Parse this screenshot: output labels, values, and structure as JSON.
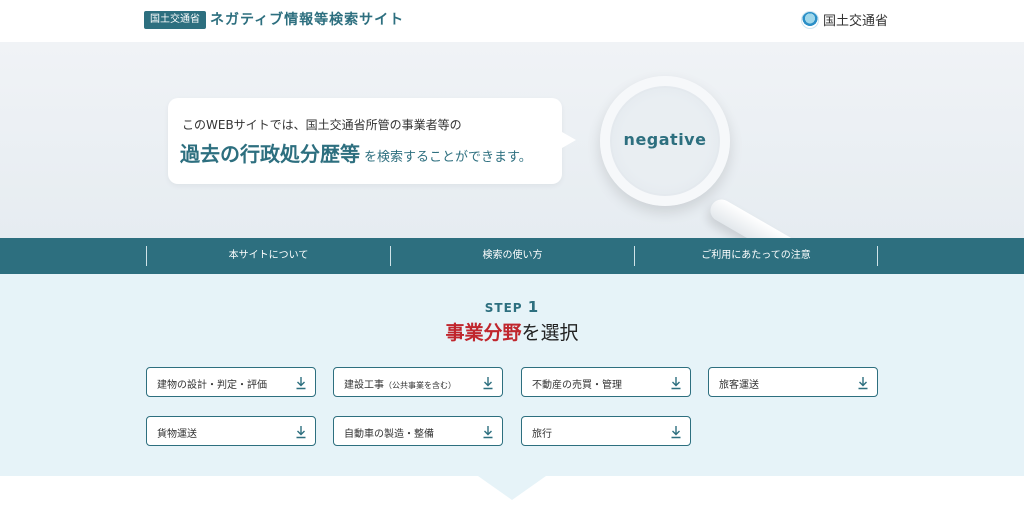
{
  "header": {
    "badge": "国土交通省",
    "title": "ネガティブ情報等検索サイト",
    "ministry": "国土交通省",
    "brand_color": "#2d6f7f"
  },
  "hero": {
    "line1": "このWEBサイトでは、国土交通省所管の事業者等の",
    "line2_strong": "過去の行政処分歴等",
    "line2_rest": "を検索することができます。",
    "lens_word": "negative"
  },
  "nav": {
    "items": [
      {
        "label": "本サイトについて"
      },
      {
        "label": "検索の使い方"
      },
      {
        "label": "ご利用にあたっての注意"
      }
    ]
  },
  "step": {
    "label": "STEP",
    "number": "1",
    "title_accent": "事業分野",
    "title_rest": "を選択",
    "accent_color": "#c0262d"
  },
  "categories": [
    {
      "label": "建物の設計・判定・評価",
      "icon": "download-arrow-icon"
    },
    {
      "label": "建設工事",
      "sub": "（公共事業を含む）",
      "icon": "download-arrow-icon"
    },
    {
      "label": "不動産の売買・管理",
      "icon": "download-arrow-icon"
    },
    {
      "label": "旅客運送",
      "icon": "download-arrow-icon"
    },
    {
      "label": "貨物運送",
      "icon": "download-arrow-icon"
    },
    {
      "label": "自動車の製造・整備",
      "icon": "download-arrow-icon"
    },
    {
      "label": "旅行",
      "icon": "download-arrow-icon"
    }
  ]
}
